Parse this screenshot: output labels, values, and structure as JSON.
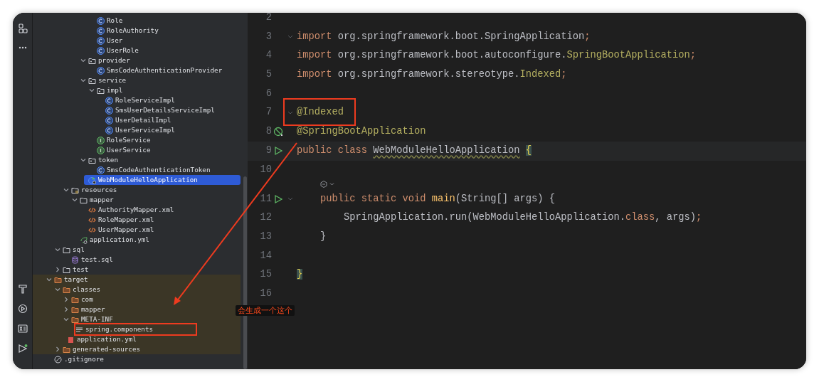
{
  "project_tree": [
    {
      "children": [
        {
          "children": [
            {
              "children": [
                {
                  "children": [
                    {
                      "children": [
                        {
                          "name": "Role",
                          "kind": "class"
                        },
                        {
                          "name": "RoleAuthority",
                          "kind": "class"
                        },
                        {
                          "name": "User",
                          "kind": "class"
                        },
                        {
                          "name": "UserRole",
                          "kind": "class"
                        }
                      ]
                    },
                    {
                      "name": "provider",
                      "kind": "package",
                      "expanded": true,
                      "children": [
                        {
                          "name": "SmsCodeAuthenticationProvider",
                          "kind": "class"
                        }
                      ]
                    },
                    {
                      "name": "service",
                      "kind": "package",
                      "expanded": true,
                      "children": [
                        {
                          "name": "impl",
                          "kind": "package",
                          "expanded": true,
                          "children": [
                            {
                              "name": "RoleServiceImpl",
                              "kind": "class"
                            },
                            {
                              "name": "SmsUserDetailsServiceImpl",
                              "kind": "class"
                            },
                            {
                              "name": "UserDetailImpl",
                              "kind": "class"
                            },
                            {
                              "name": "UserServiceImpl",
                              "kind": "class"
                            }
                          ]
                        },
                        {
                          "name": "RoleService",
                          "kind": "interface"
                        },
                        {
                          "name": "UserService",
                          "kind": "interface"
                        }
                      ]
                    },
                    {
                      "name": "token",
                      "kind": "package",
                      "expanded": true,
                      "children": [
                        {
                          "name": "SmsCodeAuthenticationToken",
                          "kind": "class"
                        }
                      ]
                    },
                    {
                      "name": "WebModuleHelloApplication",
                      "kind": "spring_class",
                      "selected": true
                    }
                  ]
                }
              ]
            },
            {
              "name": "resources",
              "kind": "resources",
              "expanded": true,
              "children": [
                {
                  "name": "mapper",
                  "kind": "folder",
                  "expanded": true,
                  "children": [
                    {
                      "name": "AuthorityMapper.xml",
                      "kind": "xml"
                    },
                    {
                      "name": "RoleMapper.xml",
                      "kind": "xml"
                    },
                    {
                      "name": "UserMapper.xml",
                      "kind": "xml"
                    }
                  ]
                },
                {
                  "name": "application.yml",
                  "kind": "spring_yml"
                }
              ]
            }
          ]
        },
        {
          "name": "sql",
          "kind": "folder",
          "expanded": true,
          "children": [
            {
              "name": "test.sql",
              "kind": "sql"
            }
          ]
        },
        {
          "name": "test",
          "kind": "folder",
          "expanded": false
        }
      ]
    },
    {
      "name": "target",
      "kind": "folder",
      "expanded": true,
      "excluded": true,
      "children": [
        {
          "name": "classes",
          "kind": "folder",
          "expanded": true,
          "excluded": true,
          "children": [
            {
              "name": "com",
              "kind": "folder",
              "expanded": false,
              "excluded": true
            },
            {
              "name": "mapper",
              "kind": "folder",
              "expanded": false,
              "excluded": true
            },
            {
              "name": "META-INF",
              "kind": "folder",
              "expanded": true,
              "excluded": true,
              "children": [
                {
                  "name": "spring.components",
                  "kind": "text",
                  "excluded": true
                }
              ]
            },
            {
              "name": "application.yml",
              "kind": "yml",
              "excluded": true
            }
          ]
        },
        {
          "name": "generated-sources",
          "kind": "folder",
          "expanded": false,
          "excluded": true
        }
      ]
    },
    {
      "name": ".gitignore",
      "kind": "ignore"
    }
  ],
  "editor": {
    "lines": [
      {
        "number": "2"
      },
      {
        "number": "3",
        "fold": true,
        "tokens": [
          {
            "text": "import ",
            "kind": "keyword"
          },
          {
            "text": "org.springframework.boot.SpringApplication",
            "kind": "plain"
          },
          {
            "text": ";",
            "kind": "keyword"
          }
        ]
      },
      {
        "number": "4",
        "tokens": [
          {
            "text": "import ",
            "kind": "keyword"
          },
          {
            "text": "org.springframework.boot.autoconfigure.",
            "kind": "plain"
          },
          {
            "text": "SpringBootApplication",
            "kind": "annotation"
          },
          {
            "text": ";",
            "kind": "keyword"
          }
        ]
      },
      {
        "number": "5",
        "tokens": [
          {
            "text": "import ",
            "kind": "keyword"
          },
          {
            "text": "org.springframework.stereotype.",
            "kind": "plain"
          },
          {
            "text": "Indexed",
            "kind": "annotation"
          },
          {
            "text": ";",
            "kind": "keyword"
          }
        ]
      },
      {
        "number": "6"
      },
      {
        "number": "7",
        "fold": true,
        "tokens": [
          {
            "text": "@Indexed",
            "kind": "annotation"
          }
        ]
      },
      {
        "number": "8",
        "gutter": {
          "kind": "bean"
        },
        "tokens": [
          {
            "text": "@SpringBootApplication",
            "kind": "annotation"
          }
        ]
      },
      {
        "number": "9",
        "gutter": {
          "kind": "run"
        },
        "current": true,
        "tokens": [
          {
            "text": "public class ",
            "kind": "keyword"
          },
          {
            "text": "WebModuleHelloApplication",
            "kind": "plain",
            "warning": true
          },
          {
            "text": " {",
            "kind": "brace",
            "matched": true
          }
        ]
      },
      {
        "number": "10"
      },
      {
        "number": "11",
        "gutter": {
          "kind": "run"
        },
        "fold": true,
        "code_vision": true,
        "tokens": [
          {
            "text": "    public static void ",
            "kind": "keyword"
          },
          {
            "text": "main",
            "kind": "method"
          },
          {
            "text": "(String[] args) {",
            "kind": "plain"
          }
        ]
      },
      {
        "number": "12",
        "tokens": [
          {
            "text": "        SpringApplication.run(WebModuleHelloApplication.",
            "kind": "plain"
          },
          {
            "text": "class",
            "kind": "keyword"
          },
          {
            "text": ", args)",
            "kind": "plain"
          },
          {
            "text": ";",
            "kind": "keyword"
          }
        ]
      },
      {
        "number": "13",
        "tokens": [
          {
            "text": "    }",
            "kind": "plain"
          }
        ]
      },
      {
        "number": "14"
      },
      {
        "number": "15",
        "tokens": [
          {
            "text": "}",
            "kind": "brace",
            "matched": true
          }
        ]
      },
      {
        "number": "16"
      }
    ]
  },
  "callout": {
    "label": "会生成一个这个"
  }
}
